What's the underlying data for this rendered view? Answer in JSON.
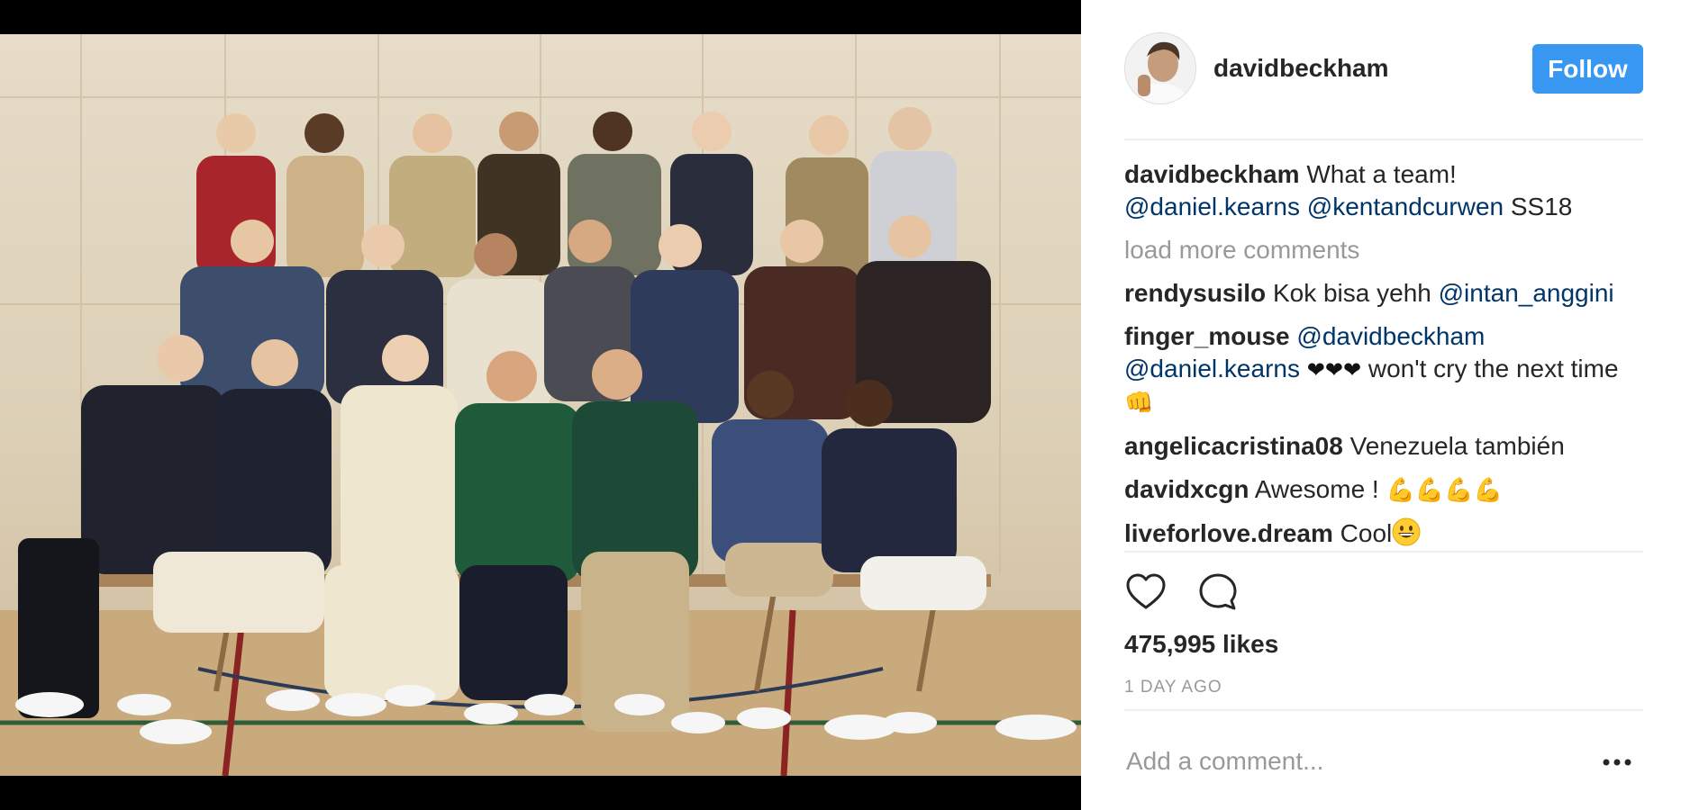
{
  "post": {
    "username": "davidbeckham",
    "follow_label": "Follow",
    "caption": {
      "author": "davidbeckham",
      "text": "What a team!",
      "mention_1": "@daniel.kearns",
      "mention_2": "@kentandcurwen",
      "tail": "SS18"
    },
    "load_more_label": "load more comments",
    "comments": [
      {
        "author": "rendysusilo",
        "text": "Kok bisa yehh",
        "mention": "@intan_anggini"
      },
      {
        "author": "finger_mouse",
        "mention_1": "@davidbeckham",
        "mention_2": "@daniel.kearns",
        "hearts": "❤❤❤",
        "text": "won't cry the next time",
        "emoji": "👊"
      },
      {
        "author": "angelicacristina08",
        "text": "Venezuela también"
      },
      {
        "author": "davidxcgn",
        "text": "Awesome !",
        "emoji": "💪💪💪💪"
      },
      {
        "author": "liveforlove.dream",
        "text": "Cool",
        "emoji": "😀"
      }
    ],
    "likes": "475,995 likes",
    "timestamp": "1 DAY AGO",
    "comment_placeholder": "Add a comment...",
    "more_label": "•••"
  },
  "icons": {
    "like": "heart-outline-icon",
    "comment": "speech-bubble-icon",
    "more": "ellipsis-icon"
  },
  "colors": {
    "follow_button": "#3897f0",
    "mention": "#003569",
    "muted_text": "#999999",
    "text": "#262626"
  }
}
